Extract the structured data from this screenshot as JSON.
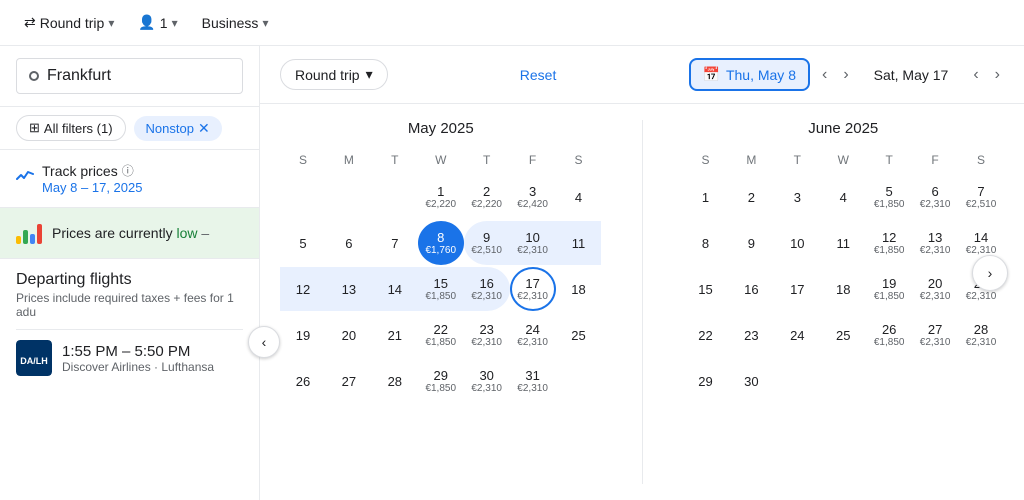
{
  "topBar": {
    "roundTrip": "Round trip",
    "passengers": "1",
    "cabinClass": "Business",
    "chevron": "▾"
  },
  "sidebar": {
    "origin": "Frankfurt",
    "originDot": "○",
    "filters": {
      "allFilters": "All filters (1)",
      "nonstop": "Nonstop"
    },
    "trackPrices": {
      "label": "Track prices",
      "infoIcon": "ⓘ",
      "dateRange": "May 8 – 17, 2025"
    },
    "priceBanner": {
      "text": "Prices are currently low",
      "lowLabel": "low",
      "dash": "–"
    },
    "departingFlights": {
      "title": "Departing flights",
      "subtitle": "Prices include required taxes + fees for 1 adu",
      "flights": [
        {
          "time": "1:55 PM – 5:50 PM",
          "carrier": "Discover Airlines · Lufthansa"
        }
      ]
    }
  },
  "calHeader": {
    "roundTrip": "Round trip",
    "chevron": "▾",
    "reset": "Reset",
    "selectedDate": "Thu, May 8",
    "calIcon": "📅",
    "returnDate": "Sat, May 17"
  },
  "mayCalendar": {
    "title": "May 2025",
    "weekdays": [
      "S",
      "M",
      "T",
      "W",
      "T",
      "F",
      "S"
    ],
    "startOffset": 3,
    "days": [
      {
        "num": 1,
        "price": "€2,220"
      },
      {
        "num": 2,
        "price": "€2,220"
      },
      {
        "num": 3,
        "price": "€2,420"
      },
      {
        "num": 4,
        "price": null
      },
      {
        "num": 5,
        "price": null
      },
      {
        "num": 6,
        "price": null
      },
      {
        "num": 7,
        "price": null
      },
      {
        "num": 8,
        "price": "€1,760",
        "selectedStart": true
      },
      {
        "num": 9,
        "price": "€2,510"
      },
      {
        "num": 10,
        "price": "€2,310"
      },
      {
        "num": 11,
        "price": null
      },
      {
        "num": 12,
        "price": null
      },
      {
        "num": 13,
        "price": null
      },
      {
        "num": 14,
        "price": null
      },
      {
        "num": 15,
        "price": "€1,850"
      },
      {
        "num": 16,
        "price": "€2,310"
      },
      {
        "num": 17,
        "price": "€2,310",
        "selectedEnd": true
      },
      {
        "num": 18,
        "price": null
      },
      {
        "num": 19,
        "price": null
      },
      {
        "num": 20,
        "price": null
      },
      {
        "num": 21,
        "price": null
      },
      {
        "num": 22,
        "price": "€1,850"
      },
      {
        "num": 23,
        "price": "€2,310"
      },
      {
        "num": 24,
        "price": "€2,310"
      },
      {
        "num": 25,
        "price": null
      },
      {
        "num": 26,
        "price": null
      },
      {
        "num": 27,
        "price": null
      },
      {
        "num": 28,
        "price": null
      },
      {
        "num": 29,
        "price": "€1,850"
      },
      {
        "num": 30,
        "price": "€2,310"
      },
      {
        "num": 31,
        "price": "€2,310"
      }
    ]
  },
  "juneCalendar": {
    "title": "June 2025",
    "weekdays": [
      "S",
      "M",
      "T",
      "W",
      "T",
      "F",
      "S"
    ],
    "startOffset": 0,
    "days": [
      {
        "num": 1,
        "price": null
      },
      {
        "num": 2,
        "price": null
      },
      {
        "num": 3,
        "price": null
      },
      {
        "num": 4,
        "price": null
      },
      {
        "num": 5,
        "price": "€1,850"
      },
      {
        "num": 6,
        "price": "€2,310"
      },
      {
        "num": 7,
        "price": "€2,510"
      },
      {
        "num": 8,
        "price": null
      },
      {
        "num": 9,
        "price": null
      },
      {
        "num": 10,
        "price": null
      },
      {
        "num": 11,
        "price": null
      },
      {
        "num": 12,
        "price": "€1,850"
      },
      {
        "num": 13,
        "price": "€2,310"
      },
      {
        "num": 14,
        "price": "€2,310"
      },
      {
        "num": 15,
        "price": null
      },
      {
        "num": 16,
        "price": null
      },
      {
        "num": 17,
        "price": null
      },
      {
        "num": 18,
        "price": null
      },
      {
        "num": 19,
        "price": "€1,850"
      },
      {
        "num": 20,
        "price": "€2,310"
      },
      {
        "num": 21,
        "price": "€2,310"
      },
      {
        "num": 22,
        "price": null
      },
      {
        "num": 23,
        "price": null
      },
      {
        "num": 24,
        "price": null
      },
      {
        "num": 25,
        "price": null
      },
      {
        "num": 26,
        "price": "€1,850"
      },
      {
        "num": 27,
        "price": "€2,310"
      },
      {
        "num": 28,
        "price": "€2,310"
      },
      {
        "num": 29,
        "price": null
      },
      {
        "num": 30,
        "price": null
      }
    ]
  },
  "icons": {
    "roundTrip": "⇄",
    "person": "👤",
    "chevronDown": "▾",
    "trackLine": "📈",
    "calendarIcon": "📅",
    "leftArrow": "‹",
    "rightArrow": "›",
    "closeX": "✕",
    "filterIcon": "≡"
  },
  "colors": {
    "blue": "#1a73e8",
    "lightBlue": "#e8f0fe",
    "green": "#188038",
    "lightGreen": "#e8f5e9"
  }
}
